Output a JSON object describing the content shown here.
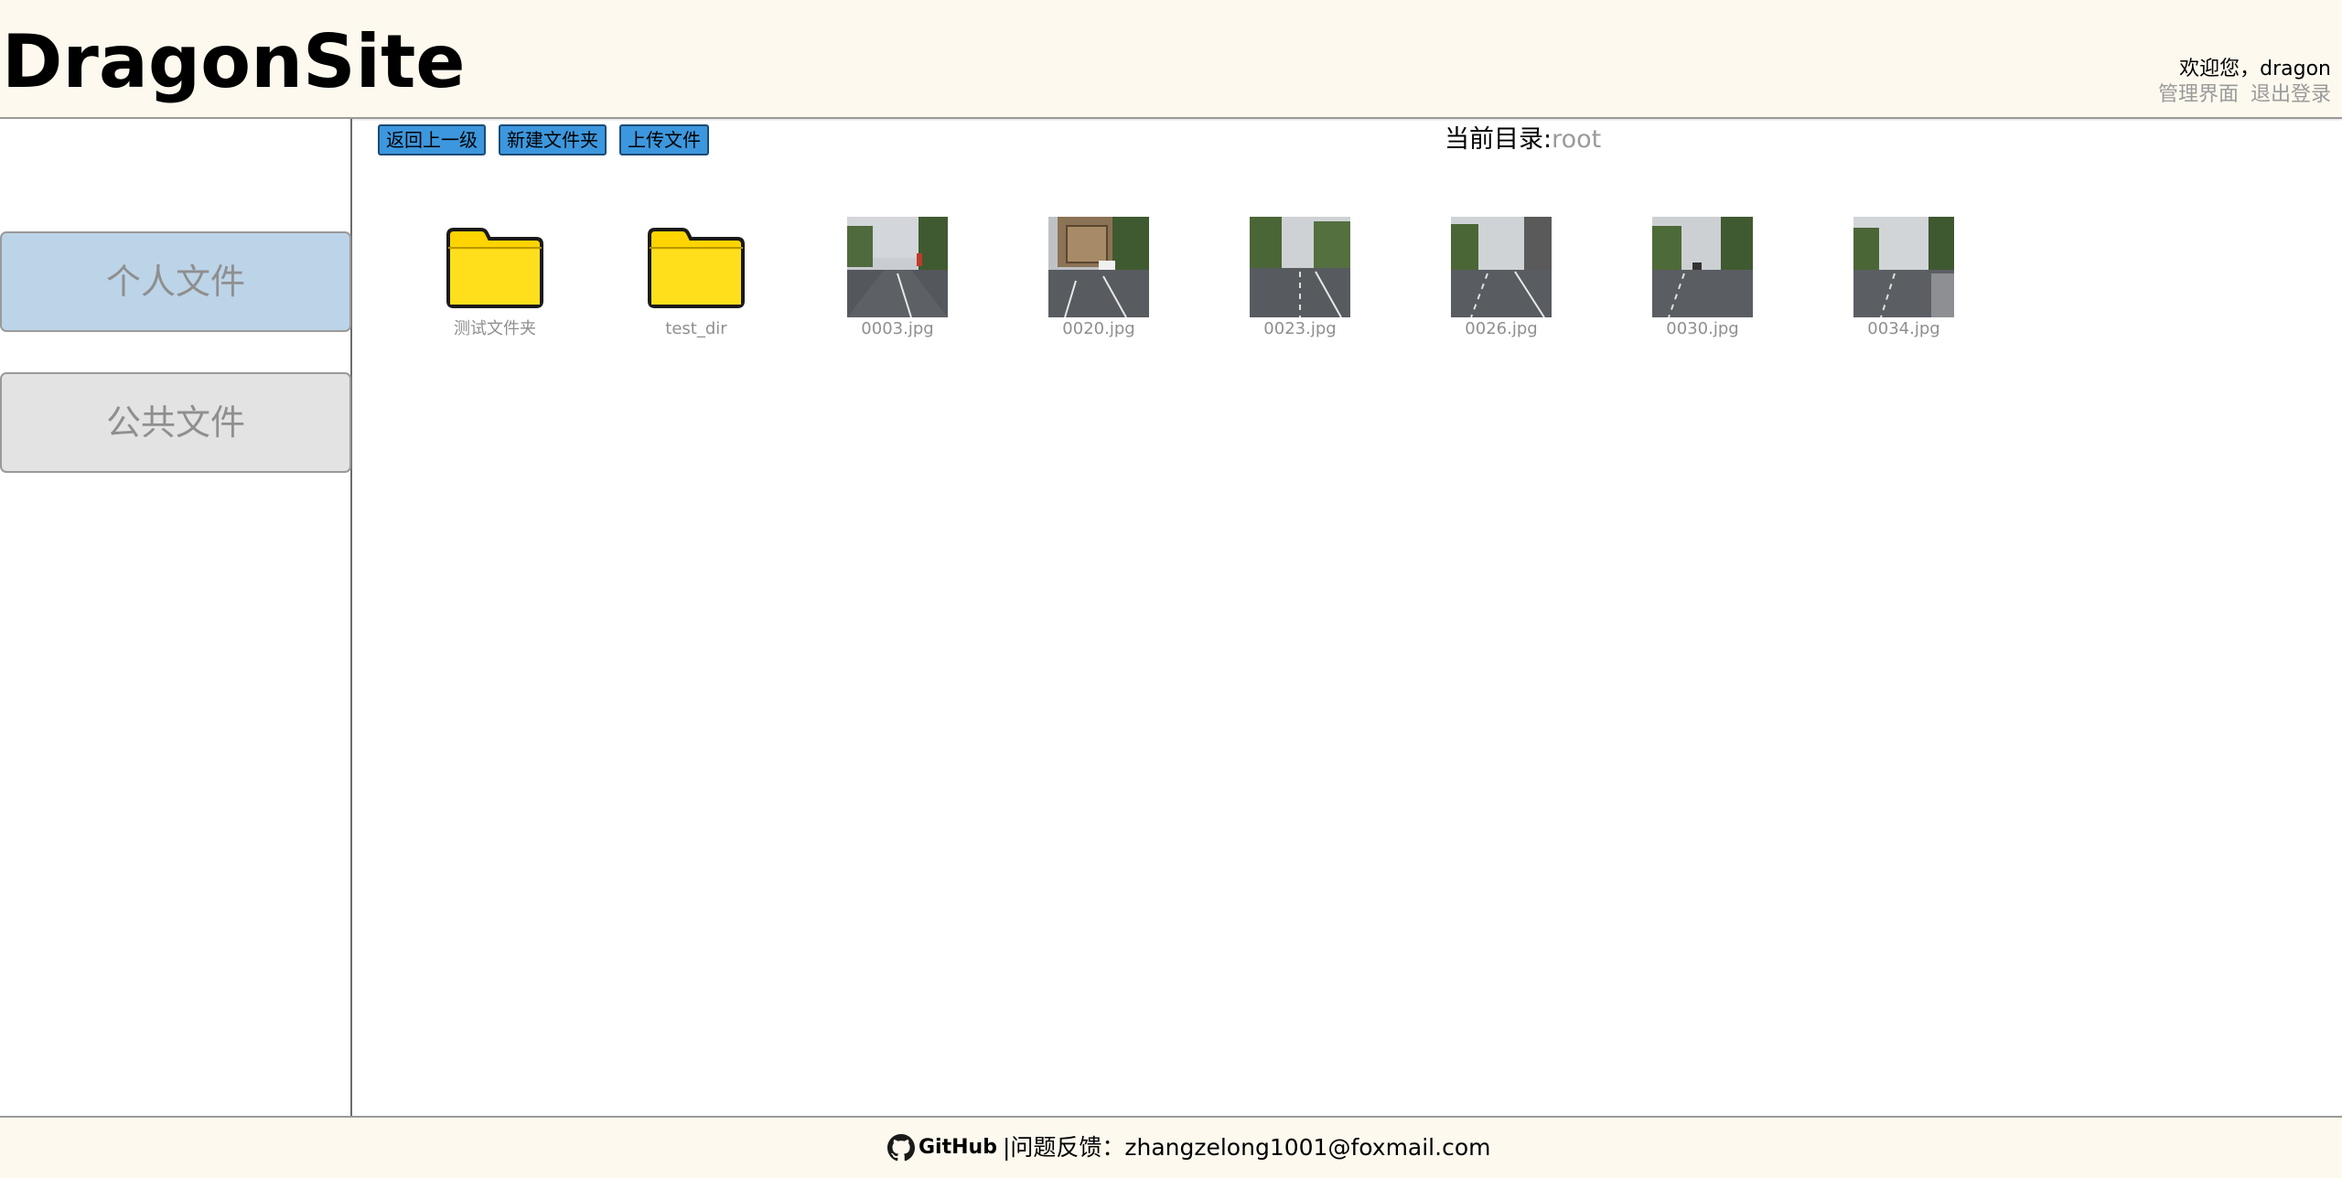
{
  "header": {
    "logo": "DragonSite",
    "welcome": "欢迎您，dragon",
    "admin_link": "管理界面",
    "logout_link": "退出登录"
  },
  "sidebar": {
    "items": [
      {
        "label": "个人文件"
      },
      {
        "label": "公共文件"
      }
    ]
  },
  "toolbar": {
    "back_label": "返回上一级",
    "new_folder_label": "新建文件夹",
    "upload_label": "上传文件"
  },
  "current_dir": {
    "label": "当前目录:",
    "value": "root"
  },
  "files": [
    {
      "name": "测试文件夹",
      "type": "folder"
    },
    {
      "name": "test_dir",
      "type": "folder"
    },
    {
      "name": "0003.jpg",
      "type": "image"
    },
    {
      "name": "0020.jpg",
      "type": "image"
    },
    {
      "name": "0023.jpg",
      "type": "image"
    },
    {
      "name": "0026.jpg",
      "type": "image"
    },
    {
      "name": "0030.jpg",
      "type": "image"
    },
    {
      "name": "0034.jpg",
      "type": "image"
    }
  ],
  "footer": {
    "github_label": "GitHub",
    "feedback": "|问题反馈：zhangzelong1001@foxmail.com"
  },
  "colors": {
    "header_bg": "#fef9ee",
    "button_bg": "#3c97de",
    "personal_bg": "#bcd4e8",
    "public_bg": "#e3e3e3",
    "folder_yellow": "#ffd700"
  }
}
